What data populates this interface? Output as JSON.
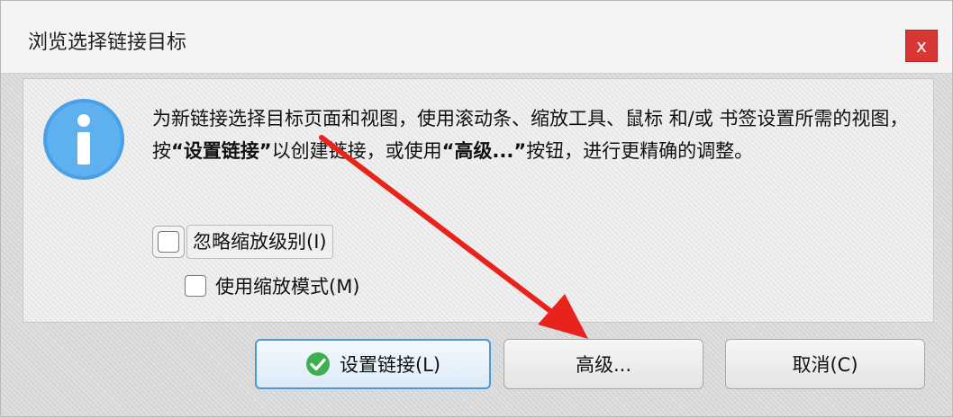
{
  "window": {
    "title": "浏览选择链接目标",
    "close_label": "x"
  },
  "message": {
    "part1": "为新链接选择目标页面和视图，使用滚动条、缩放工具、鼠标 和/或 书签设置所需的视图，按",
    "bold1": "“设置链接”",
    "part2": "以创建链接，或使用",
    "bold2": "“高级...”",
    "part3": "按钮，进行更精确的调整。"
  },
  "options": {
    "ignore_zoom_label": "忽略缩放级别(I)",
    "ignore_zoom_checked": false,
    "use_zoom_mode_label": "使用缩放模式(M)",
    "use_zoom_mode_checked": false
  },
  "buttons": {
    "set_link": "设置链接(L)",
    "advanced": "高级...",
    "cancel": "取消(C)"
  },
  "colors": {
    "close_bg": "#d93636",
    "info_icon": "#4aa0e6",
    "check_icon": "#3fb04f",
    "annotation_arrow": "#e8231c"
  },
  "icons": [
    "info-icon",
    "close-icon",
    "check-icon",
    "annotation-arrow"
  ]
}
